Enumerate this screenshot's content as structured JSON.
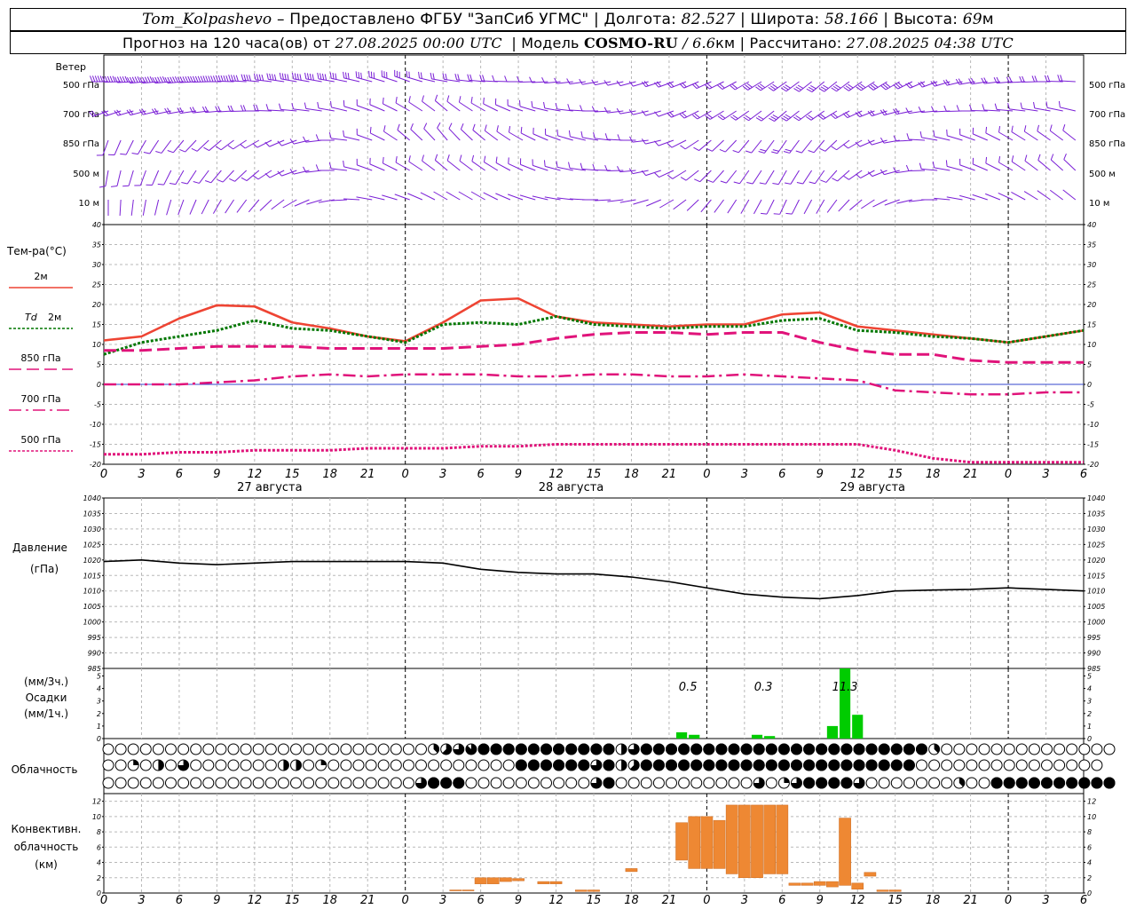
{
  "header": {
    "station": "Tom_Kolpashevo",
    "dash": "–",
    "provider": "Предоставлено ФГБУ \"ЗапСиб УГМС\"",
    "lon_label": "Долгота:",
    "lon_value": "82.527",
    "lat_label": "Широта:",
    "lat_value": "58.166",
    "alt_label": "Высота:",
    "alt_value": "69",
    "alt_unit": "м",
    "forecast_label": "Прогноз на 120 часа(ов)",
    "from_label": "от",
    "start_time": "27.08.2025 00:00 UTC",
    "model_label": "Модель",
    "model_name": "COSMO-RU",
    "model_slash": "/",
    "model_res": "6.6",
    "model_res_unit": "км",
    "computed_label": "Рассчитано:",
    "computed_time": "27.08.2025 04:38 UTC",
    "sep": "|"
  },
  "colors": {
    "t2m": "#ee4433",
    "td2m": "#007700",
    "t_upper": "#e0137a",
    "wind": "#7a1fd6",
    "pressure": "#000000",
    "precip": "#00cc00",
    "convective": "#ee8833",
    "zero_line": "#3344cc"
  },
  "chart_data": [
    {
      "type": "wind-barbs",
      "title": "Ветер",
      "levels": [
        "500 гПа",
        "700 гПа",
        "850 гПа",
        "500  м",
        "10   м"
      ],
      "x_hours": [
        0,
        3,
        6,
        9,
        12,
        15,
        18,
        21,
        24,
        27,
        30,
        33,
        36,
        39,
        42,
        45,
        48,
        51,
        54,
        57,
        60,
        63,
        66,
        69,
        72,
        75,
        78
      ],
      "direction_deg": {
        "500 гПа": [
          270,
          265,
          265,
          270,
          275,
          280,
          280,
          285,
          290,
          280,
          275,
          270,
          265,
          260,
          255,
          250,
          245,
          240,
          235,
          230,
          235,
          240,
          250,
          260,
          265,
          270,
          275
        ],
        "700 гПа": [
          250,
          255,
          260,
          265,
          270,
          275,
          280,
          290,
          300,
          310,
          300,
          290,
          280,
          270,
          260,
          250,
          240,
          235,
          230,
          235,
          245,
          255,
          265,
          270,
          275,
          280,
          285
        ],
        "850 гПа": [
          200,
          210,
          220,
          230,
          240,
          250,
          270,
          290,
          310,
          320,
          310,
          300,
          290,
          280,
          270,
          250,
          230,
          220,
          215,
          220,
          240,
          260,
          280,
          290,
          300,
          305,
          310
        ],
        "500  м": [
          190,
          200,
          210,
          220,
          230,
          250,
          270,
          290,
          300,
          310,
          305,
          295,
          285,
          275,
          265,
          245,
          225,
          215,
          210,
          215,
          235,
          255,
          275,
          290,
          300,
          310,
          315
        ],
        "10   м": [
          180,
          190,
          200,
          210,
          220,
          240,
          260,
          280,
          290,
          300,
          300,
          290,
          280,
          270,
          260,
          240,
          220,
          210,
          205,
          210,
          230,
          250,
          270,
          285,
          295,
          305,
          310
        ]
      },
      "speed_ms": {
        "500 гПа": [
          28,
          27,
          26,
          25,
          24,
          22,
          20,
          18,
          15,
          12,
          10,
          9,
          8,
          8,
          9,
          10,
          12,
          14,
          16,
          17,
          16,
          15,
          14,
          13,
          12,
          11,
          10
        ],
        "700 гПа": [
          12,
          12,
          11,
          10,
          10,
          9,
          8,
          8,
          7,
          7,
          8,
          9,
          9,
          8,
          8,
          9,
          11,
          13,
          15,
          14,
          12,
          10,
          9,
          8,
          8,
          7,
          7
        ],
        "850 гПа": [
          7,
          7,
          8,
          8,
          9,
          8,
          7,
          6,
          6,
          5,
          6,
          7,
          7,
          7,
          6,
          6,
          7,
          9,
          10,
          9,
          8,
          7,
          6,
          6,
          5,
          5,
          5
        ],
        "500  м": [
          6,
          6,
          7,
          8,
          8,
          7,
          6,
          6,
          5,
          5,
          6,
          6,
          7,
          6,
          6,
          6,
          7,
          8,
          9,
          8,
          7,
          6,
          6,
          5,
          5,
          5,
          5
        ],
        "10   м": [
          3,
          3,
          3,
          4,
          4,
          4,
          3,
          3,
          3,
          3,
          3,
          4,
          4,
          3,
          3,
          3,
          4,
          4,
          5,
          4,
          4,
          3,
          3,
          3,
          3,
          3,
          3
        ]
      }
    },
    {
      "type": "line",
      "title": "Тем-ра(°C)",
      "ylim": [
        -20,
        40
      ],
      "y_ticks": [
        -20,
        -15,
        -10,
        -5,
        0,
        5,
        10,
        15,
        20,
        25,
        30,
        35,
        40
      ],
      "x_hours": [
        0,
        3,
        6,
        9,
        12,
        15,
        18,
        21,
        24,
        27,
        30,
        33,
        36,
        39,
        42,
        45,
        48,
        51,
        54,
        57,
        60,
        63,
        66,
        69,
        72,
        75,
        78
      ],
      "x_tick_labels": [
        "0",
        "3",
        "6",
        "9",
        "12",
        "15",
        "18",
        "21",
        "0",
        "3",
        "6",
        "9",
        "12",
        "15",
        "18",
        "21",
        "0",
        "3",
        "6",
        "9",
        "12",
        "15",
        "18",
        "21",
        "0",
        "3",
        "6"
      ],
      "date_labels": [
        {
          "hour": 12,
          "text": "27 августа"
        },
        {
          "hour": 36,
          "text": "28 августа"
        },
        {
          "hour": 60,
          "text": "29 августа"
        }
      ],
      "series": [
        {
          "name": "2м",
          "key": "t2m",
          "style": "solid",
          "values": [
            11,
            12,
            16.5,
            19.8,
            19.5,
            15.5,
            14,
            12,
            10.8,
            15.5,
            21,
            21.5,
            17,
            15.5,
            15,
            14.5,
            15,
            15,
            17.5,
            18,
            14.5,
            13.5,
            12.5,
            11.5,
            10.5,
            12,
            13.5
          ]
        },
        {
          "name": "2м",
          "prefix": "Td",
          "key": "td2m",
          "style": "dotted",
          "values": [
            7.5,
            10.5,
            12,
            13.5,
            16,
            14,
            13.5,
            12,
            10.5,
            15,
            15.5,
            15,
            17,
            15,
            14.5,
            14,
            14.5,
            14.5,
            16,
            16.5,
            13.5,
            13,
            12,
            11.5,
            10.5,
            12,
            13.5
          ]
        },
        {
          "name": "850 гПа",
          "key": "t_upper",
          "style": "dashed",
          "values": [
            8.5,
            8.5,
            9,
            9.5,
            9.5,
            9.5,
            9,
            9,
            9,
            9,
            9.5,
            10,
            11.5,
            12.5,
            13,
            13,
            12.5,
            13,
            13,
            10.5,
            8.5,
            7.5,
            7.5,
            6,
            5.5,
            5.5,
            5.5
          ]
        },
        {
          "name": "700 гПа",
          "key": "t_upper",
          "style": "dashdot",
          "values": [
            0,
            0,
            0,
            0.5,
            1,
            2,
            2.5,
            2,
            2.5,
            2.5,
            2.5,
            2,
            2,
            2.5,
            2.5,
            2,
            2,
            2.5,
            2,
            1.5,
            1,
            -1.5,
            -2,
            -2.5,
            -2.5,
            -2,
            -2
          ]
        },
        {
          "name": "500 гПа",
          "key": "t_upper",
          "style": "densedot",
          "values": [
            -17.5,
            -17.5,
            -17,
            -17,
            -16.5,
            -16.5,
            -16.5,
            -16,
            -16,
            -16,
            -15.5,
            -15.5,
            -15,
            -15,
            -15,
            -15,
            -15,
            -15,
            -15,
            -15,
            -15,
            -16.5,
            -18.5,
            -19.5,
            -19.5,
            -19.5,
            -19.5
          ]
        }
      ]
    },
    {
      "type": "line",
      "title": "Давление",
      "unit": "(гПа)",
      "ylim": [
        985,
        1040
      ],
      "y_ticks": [
        985,
        990,
        995,
        1000,
        1005,
        1010,
        1015,
        1020,
        1025,
        1030,
        1035,
        1040
      ],
      "x_hours": [
        0,
        3,
        6,
        9,
        12,
        15,
        18,
        21,
        24,
        27,
        30,
        33,
        36,
        39,
        42,
        45,
        48,
        51,
        54,
        57,
        60,
        63,
        66,
        69,
        72,
        75,
        78
      ],
      "series": [
        {
          "name": "",
          "key": "pressure",
          "values": [
            1019.5,
            1020,
            1019,
            1018.5,
            1019,
            1019.5,
            1019.5,
            1019.5,
            1019.5,
            1019,
            1017,
            1016,
            1015.5,
            1015.5,
            1014.5,
            1013,
            1011,
            1009,
            1008,
            1007.5,
            1008.5,
            1010,
            1010.3,
            1010.5,
            1011,
            1010.5,
            1010
          ]
        }
      ]
    },
    {
      "type": "bar",
      "title": "Осадки",
      "units": [
        "(мм/3ч.)",
        "(мм/1ч.)"
      ],
      "ylim": [
        0,
        5.6
      ],
      "y_ticks": [
        0,
        1,
        2,
        3,
        4,
        5
      ],
      "bars": [
        {
          "hour": 46,
          "value": 0.5
        },
        {
          "hour": 47,
          "value": 0.3
        },
        {
          "hour": 52,
          "value": 0.3
        },
        {
          "hour": 53,
          "value": 0.2
        },
        {
          "hour": 58,
          "value": 1.0
        },
        {
          "hour": 59,
          "value": 5.8
        },
        {
          "hour": 60,
          "value": 1.9
        }
      ],
      "annotations": [
        {
          "hour": 46.5,
          "text": "0.5"
        },
        {
          "hour": 52.5,
          "text": "0.3"
        },
        {
          "hour": 59,
          "text": "11.3"
        }
      ]
    },
    {
      "type": "cloud-symbols",
      "title": "Облачность",
      "x_hours_step": 1,
      "note": "okta per layer (0 = clear, 8 = overcast), rows: top = high, middle, bottom = low",
      "rows": [
        [
          0,
          0,
          0,
          0,
          0,
          0,
          0,
          0,
          0,
          0,
          0,
          0,
          0,
          0,
          0,
          0,
          0,
          0,
          0,
          0,
          0,
          0,
          0,
          0,
          0,
          0,
          3,
          5,
          6,
          7,
          8,
          8,
          8,
          8,
          8,
          8,
          8,
          8,
          8,
          8,
          8,
          4,
          6,
          8,
          8,
          8,
          8,
          8,
          8,
          8,
          8,
          8,
          8,
          8,
          8,
          8,
          8,
          8,
          8,
          8,
          8,
          8,
          8,
          8,
          8,
          8,
          3,
          0,
          0,
          0,
          0,
          0,
          0,
          0,
          0,
          0,
          0,
          0,
          0,
          0,
          0
        ],
        [
          0,
          0,
          2,
          0,
          4,
          0,
          6,
          0,
          0,
          0,
          0,
          0,
          0,
          0,
          4,
          4,
          0,
          2,
          0,
          0,
          0,
          0,
          0,
          0,
          0,
          0,
          0,
          0,
          0,
          0,
          0,
          0,
          0,
          8,
          8,
          8,
          8,
          8,
          8,
          6,
          8,
          4,
          5,
          8,
          8,
          8,
          8,
          8,
          8,
          8,
          8,
          8,
          8,
          8,
          8,
          8,
          8,
          8,
          8,
          8,
          8,
          8,
          8,
          8,
          8,
          0,
          0,
          0,
          0,
          0,
          0,
          0,
          0,
          0,
          0,
          0,
          0,
          0,
          0,
          0
        ],
        [
          0,
          0,
          0,
          0,
          0,
          0,
          0,
          0,
          0,
          0,
          0,
          0,
          0,
          0,
          0,
          0,
          0,
          0,
          0,
          0,
          0,
          0,
          0,
          0,
          0,
          6,
          8,
          8,
          8,
          0,
          0,
          0,
          0,
          0,
          0,
          0,
          0,
          0,
          0,
          6,
          8,
          0,
          0,
          0,
          0,
          0,
          0,
          0,
          0,
          0,
          0,
          0,
          6,
          0,
          2,
          6,
          8,
          8,
          8,
          8,
          6,
          0,
          0,
          0,
          0,
          0,
          0,
          0,
          3,
          0,
          0,
          8,
          8,
          8,
          8,
          8,
          8,
          8,
          8,
          8,
          8
        ]
      ]
    },
    {
      "type": "range-bar",
      "title": "Конвективн. облачность",
      "unit": "(км)",
      "ylim": [
        0,
        13
      ],
      "y_ticks": [
        0,
        2,
        4,
        6,
        8,
        10,
        12
      ],
      "x_hours": [
        0,
        3,
        6,
        9,
        12,
        15,
        18,
        21,
        24,
        27,
        30,
        33,
        36,
        39,
        42,
        45,
        48,
        51,
        54,
        57,
        60,
        63,
        66,
        69,
        72,
        75,
        78
      ],
      "x_tick_labels": [
        "0",
        "3",
        "6",
        "9",
        "12",
        "15",
        "18",
        "21",
        "0",
        "3",
        "6",
        "9",
        "12",
        "15",
        "18",
        "21",
        "0",
        "3",
        "6",
        "9",
        "12",
        "15",
        "18",
        "21",
        "0",
        "3",
        "6"
      ],
      "bars": [
        {
          "hour": 28,
          "bottom": 0.3,
          "top": 0.4
        },
        {
          "hour": 29,
          "bottom": 0.3,
          "top": 0.4
        },
        {
          "hour": 30,
          "bottom": 1.2,
          "top": 2.0
        },
        {
          "hour": 31,
          "bottom": 1.2,
          "top": 2.0
        },
        {
          "hour": 32,
          "bottom": 1.5,
          "top": 2.0
        },
        {
          "hour": 33,
          "bottom": 1.6,
          "top": 1.9
        },
        {
          "hour": 35,
          "bottom": 1.2,
          "top": 1.5
        },
        {
          "hour": 36,
          "bottom": 1.2,
          "top": 1.5
        },
        {
          "hour": 38,
          "bottom": 0.2,
          "top": 0.4
        },
        {
          "hour": 39,
          "bottom": 0.2,
          "top": 0.4
        },
        {
          "hour": 42,
          "bottom": 2.8,
          "top": 3.2
        },
        {
          "hour": 46,
          "bottom": 4.3,
          "top": 9.2
        },
        {
          "hour": 47,
          "bottom": 3.2,
          "top": 10.0
        },
        {
          "hour": 48,
          "bottom": 3.2,
          "top": 10.0
        },
        {
          "hour": 49,
          "bottom": 3.2,
          "top": 9.5
        },
        {
          "hour": 50,
          "bottom": 2.5,
          "top": 11.5
        },
        {
          "hour": 51,
          "bottom": 2.0,
          "top": 11.5
        },
        {
          "hour": 52,
          "bottom": 2.0,
          "top": 11.5
        },
        {
          "hour": 53,
          "bottom": 2.5,
          "top": 11.5
        },
        {
          "hour": 54,
          "bottom": 2.5,
          "top": 11.5
        },
        {
          "hour": 55,
          "bottom": 1.0,
          "top": 1.3
        },
        {
          "hour": 56,
          "bottom": 1.0,
          "top": 1.3
        },
        {
          "hour": 57,
          "bottom": 1.0,
          "top": 1.5
        },
        {
          "hour": 58,
          "bottom": 0.8,
          "top": 1.5
        },
        {
          "hour": 59,
          "bottom": 1.0,
          "top": 9.8
        },
        {
          "hour": 60,
          "bottom": 0.5,
          "top": 1.3
        },
        {
          "hour": 61,
          "bottom": 2.2,
          "top": 2.7
        },
        {
          "hour": 62,
          "bottom": 0.2,
          "top": 0.4
        },
        {
          "hour": 63,
          "bottom": 0.2,
          "top": 0.4
        }
      ]
    }
  ]
}
